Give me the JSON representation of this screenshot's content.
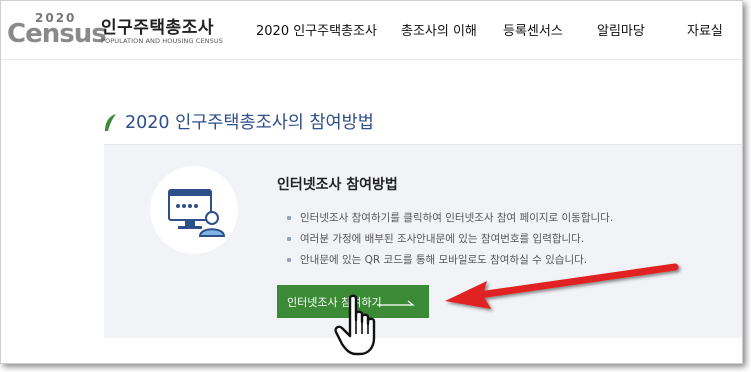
{
  "logo": {
    "year": "2020",
    "wordmark": "Census",
    "title": "인구주택총조사",
    "subtitle": "POPULATION AND HOUSING CENSUS"
  },
  "nav": {
    "items": [
      {
        "label": "2020 인구주택총조사"
      },
      {
        "label": "총조사의 이해"
      },
      {
        "label": "등록센서스"
      },
      {
        "label": "알림마당"
      },
      {
        "label": "자료실"
      }
    ]
  },
  "section": {
    "title": "2020 인구주택총조사의 참여방법"
  },
  "panel": {
    "heading": "인터넷조사 참여방법",
    "bullets": [
      "인터넷조사 참여하기를 클릭하여 인터넷조사 참여 페이지로 이동합니다.",
      "여러분 가정에 배부된 조사안내문에 있는 참여번호를 입력합니다.",
      "안내문에 있는 QR 코드를 통해 모바일로도 참여하실 수 있습니다."
    ],
    "button_label": "인터넷조사 참여하기"
  },
  "colors": {
    "accent_green": "#3b8b36",
    "title_blue": "#2d4f8a",
    "annotation_red": "#e02020"
  },
  "icons": {
    "computer_user": "computer-user-icon",
    "leaf": "leaf-icon",
    "hand_cursor": "hand-pointer-icon",
    "annotation_arrow": "red-arrow-icon"
  }
}
